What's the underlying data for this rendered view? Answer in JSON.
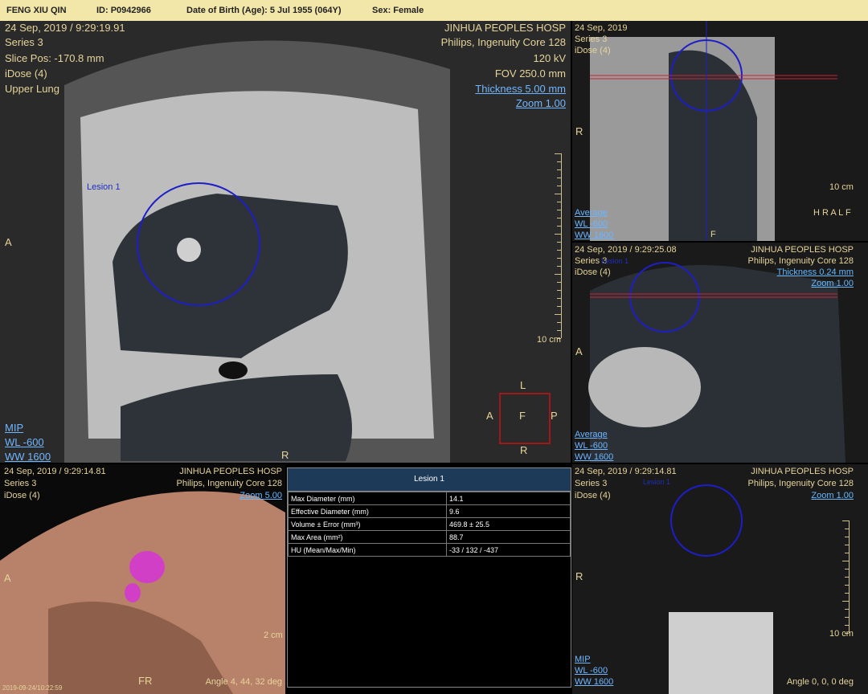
{
  "header": {
    "patient": "FENG XIU QIN",
    "id": "ID: P0942966",
    "dob": "Date of Birth (Age): 5 Jul 1955 (064Y)",
    "sex": "Sex: Female"
  },
  "axial": {
    "datetime": "24 Sep, 2019 / 9:29:19.91",
    "series": "Series 3",
    "slice": "Slice Pos: -170.8 mm",
    "idose": "iDose (4)",
    "region": "Upper Lung",
    "hospital": "JINHUA PEOPLES HOSP",
    "scanner": "Philips, Ingenuity Core 128",
    "kv": "120 kV",
    "fov": "FOV 250.0 mm",
    "thickness": "Thickness 5.00 mm",
    "zoom": "Zoom 1.00",
    "lesion_label": "Lesion 1",
    "scale": "10 cm",
    "mode": "MIP",
    "wl": "WL  -600",
    "ww": "WW  1600",
    "orient_left": "A",
    "orient_right": "R",
    "cube": {
      "top": "L",
      "left": "A",
      "center": "F",
      "right": "P",
      "bottom": "R"
    }
  },
  "coronal": {
    "datetime": "24 Sep, 2019",
    "series": "Series 3",
    "idose": "iDose (4)",
    "orient_r": "R",
    "orient_f": "F",
    "scale": "10 cm",
    "mode": "Average",
    "wl": "WL  -600",
    "ww": "WW  1600",
    "cube": "H R A L F"
  },
  "sagittal": {
    "datetime": "24 Sep, 2019 / 9:29:25.08",
    "series": "Series 3",
    "idose": "iDose (4)",
    "hospital": "JINHUA PEOPLES HOSP",
    "scanner": "Philips, Ingenuity Core 128",
    "thickness": "Thickness 0.24 mm",
    "zoom": "Zoom 1.00",
    "lesion_label": "Lesion 1",
    "orient_a": "A",
    "mode": "Average",
    "wl": "WL  -600",
    "ww": "WW  1600"
  },
  "volume": {
    "datetime": "24 Sep, 2019 / 9:29:14.81",
    "series": "Series 3",
    "idose": "iDose (4)",
    "hospital": "JINHUA PEOPLES HOSP",
    "scanner": "Philips, Ingenuity Core 128",
    "zoom": "Zoom 5.00",
    "orient_a": "A",
    "orient_fr": "FR",
    "angle": "Angle 4, 44, 32 deg",
    "scale": "2 cm",
    "footer_time": "2019-09-24/10:22:59"
  },
  "measurements": {
    "title": "Lesion 1",
    "rows": [
      {
        "label": "Max Diameter (mm)",
        "value": "14.1"
      },
      {
        "label": "Effective Diameter (mm)",
        "value": "9.6"
      },
      {
        "label": "Volume ± Error (mm³)",
        "value": "469.8 ± 25.5"
      },
      {
        "label": "Max Area (mm²)",
        "value": "88.7"
      },
      {
        "label": "HU (Mean/Max/Min)",
        "value": "-33 / 132 / -437"
      }
    ]
  },
  "mip_pane": {
    "datetime": "24 Sep, 2019 / 9:29:14.81",
    "series": "Series 3",
    "idose": "iDose (4)",
    "hospital": "JINHUA PEOPLES HOSP",
    "scanner": "Philips, Ingenuity Core 128",
    "zoom": "Zoom 1.00",
    "lesion_label": "Lesion 1",
    "orient_r": "R",
    "scale": "10 cm",
    "mode": "MIP",
    "wl": "WL  -600",
    "ww": "WW  1600",
    "angle": "Angle 0, 0, 0 deg"
  }
}
